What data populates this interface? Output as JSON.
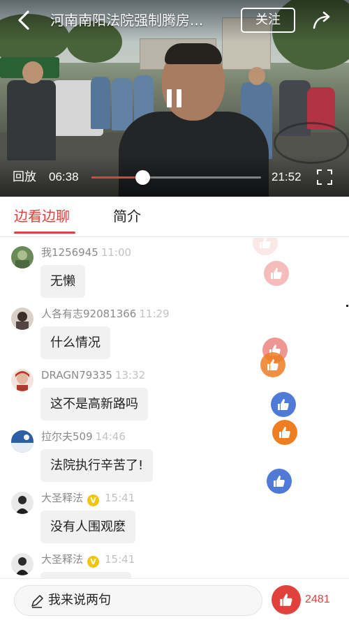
{
  "video": {
    "title": "河南南阳法院强制腾房...",
    "follow_label": "关注",
    "replay_label": "回放",
    "current_time": "06:38",
    "total_time": "21:52",
    "progress": 0.3
  },
  "tabs": [
    {
      "label": "边看边聊",
      "active": true
    },
    {
      "label": "简介",
      "active": false
    }
  ],
  "messages": [
    {
      "user": "我1256945",
      "time": "11:00",
      "text": "无懒",
      "verified": false
    },
    {
      "user": "人各有志92081366",
      "time": "11:29",
      "text": "什么情况",
      "verified": false
    },
    {
      "user": "DRAGN79335",
      "time": "13:32",
      "text": "这不是高新路吗",
      "verified": false
    },
    {
      "user": "拉尔夫509",
      "time": "14:46",
      "text": "法院执行辛苦了!",
      "verified": false
    },
    {
      "user": "大圣释法",
      "time": "15:41",
      "text": "没有人围观麽",
      "verified": true
    },
    {
      "user": "大圣释法",
      "time": "15:41",
      "text": "",
      "verified": true
    }
  ],
  "verified_mark": "V",
  "comment_placeholder": "我来说两句",
  "like_count": "2481",
  "colors": {
    "accent": "#e0413d",
    "like_red": "#e0413d",
    "like_blue": "#4f7bd6",
    "like_orange": "#ef7d22"
  }
}
